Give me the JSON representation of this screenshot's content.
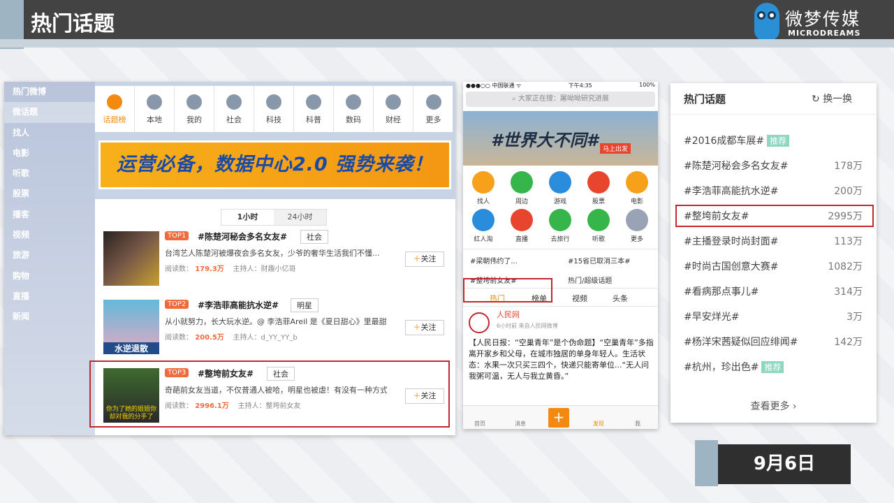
{
  "header": {
    "title": "热门话题",
    "logo_cn": "微梦传媒",
    "logo_en": "MICRODREAMS"
  },
  "sidebar": {
    "items": [
      "热门微博",
      "微话题",
      "找人",
      "电影",
      "听歌",
      "股票",
      "播客",
      "视频",
      "旅游",
      "购物",
      "直播",
      "新闻"
    ]
  },
  "toolbar": {
    "items": [
      "话题榜",
      "本地",
      "我的",
      "社会",
      "科技",
      "科普",
      "数码",
      "财经",
      "更多"
    ]
  },
  "banner": {
    "text": "运营必备，数据中心2.0 强势来袭！"
  },
  "list": {
    "tabs": [
      "1小时",
      "24小时"
    ],
    "follow_label": "关注",
    "read_label": "阅读数：",
    "host_label": "主持人：",
    "rows": [
      {
        "rank": "TOP1",
        "title": "#陈楚河秘会多名女友#",
        "category": "社会",
        "desc": "台湾艺人陈楚河被爆夜会多名女友，少爷的奢华生活我们不懂...",
        "reads": "179.3万",
        "host": "财趣小亿哥"
      },
      {
        "rank": "TOP2",
        "title": "#李浩菲高能抗水逆#",
        "category": "明星",
        "desc": "从小就努力，长大玩水逆。@ 李浩菲Areil 是《夏日甜心》里最甜的别",
        "reads": "200.5万",
        "host": "d_YY_YY_b",
        "thumb_text": "水逆退散"
      },
      {
        "rank": "TOP3",
        "title": "#整垮前女友#",
        "category": "社会",
        "desc": "奇葩前女友当道，不仅普通人被哈，明星也被虐！有没有一种方式能整",
        "reads": "2996.1万",
        "host": "整垮前女友",
        "thumb_text": "你为了她的姐姐你却对我的分手了"
      }
    ]
  },
  "phone": {
    "status_left": "●●●○○ 中国联通 ᯤ",
    "status_time": "下午4:35",
    "status_right": "100%",
    "search": "大家正在搜：屠呦呦研究进展",
    "banner_text": "#世界大不同#",
    "banner_btn": "马上出发",
    "icons": [
      "找人",
      "周边",
      "游戏",
      "股票",
      "电影",
      "红人淘",
      "直播",
      "去旅行",
      "听歌",
      "更多"
    ],
    "topics": [
      "#梁朝伟约了...",
      "#15省已取消三本#",
      "#整垮前女友#",
      "热门/超级话题"
    ],
    "tabs": [
      "热门",
      "榜单",
      "视频",
      "头条"
    ],
    "post": {
      "name": "人民网",
      "time": "6小时前 来自人民网微博",
      "text": "【人民日报：“空巢青年”是个伪命题】“空巢青年”多指离开家乡和父母，在城市独居的单身年轻人。生活状态：水果一次只买三四个，快递只能寄单位...“无人问我粥可温，无人与我立黄昏。”"
    },
    "bottom": [
      "首页",
      "消息",
      "",
      "发现",
      "我"
    ]
  },
  "hot": {
    "title": "热门话题",
    "switch": "换一换",
    "more": "查看更多 ›",
    "rec": "推荐",
    "items": [
      {
        "t": "#2016成都车展#",
        "n": "",
        "rec": true
      },
      {
        "t": "#陈楚河秘会多名女友#",
        "n": "178万"
      },
      {
        "t": "#李浩菲高能抗水逆#",
        "n": "200万"
      },
      {
        "t": "#整垮前女友#",
        "n": "2995万"
      },
      {
        "t": "#主播登录时尚封面#",
        "n": "113万"
      },
      {
        "t": "#时尚古国创意大赛#",
        "n": "1082万"
      },
      {
        "t": "#看病那点事儿#",
        "n": "314万"
      },
      {
        "t": "#早安烊光#",
        "n": "3万"
      },
      {
        "t": "#杨洋宋茜疑似回应绯闻#",
        "n": "142万"
      },
      {
        "t": "#杭州，珍出色#",
        "n": "",
        "rec": true
      }
    ]
  },
  "date": "9月6日"
}
